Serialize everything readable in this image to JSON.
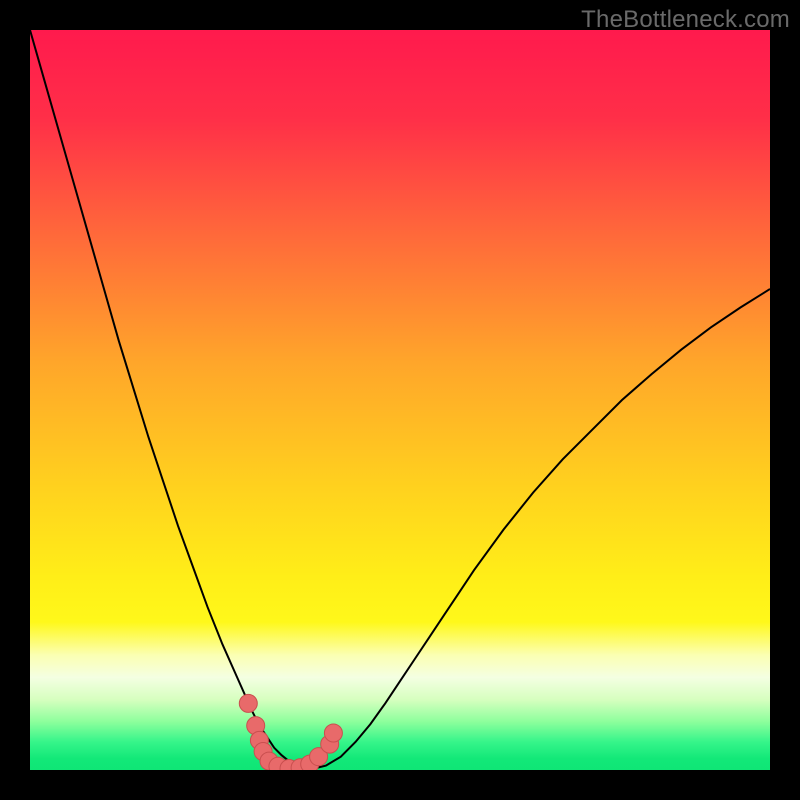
{
  "watermark": "TheBottleneck.com",
  "colors": {
    "frame": "#000000",
    "gradient_stops": [
      {
        "offset": 0.0,
        "color": "#ff1a4d"
      },
      {
        "offset": 0.12,
        "color": "#ff2f48"
      },
      {
        "offset": 0.28,
        "color": "#ff6a3a"
      },
      {
        "offset": 0.45,
        "color": "#ffa62a"
      },
      {
        "offset": 0.62,
        "color": "#ffd21e"
      },
      {
        "offset": 0.74,
        "color": "#ffee18"
      },
      {
        "offset": 0.8,
        "color": "#fff81a"
      },
      {
        "offset": 0.845,
        "color": "#fbffb3"
      },
      {
        "offset": 0.875,
        "color": "#f4ffe2"
      },
      {
        "offset": 0.905,
        "color": "#d6ffbf"
      },
      {
        "offset": 0.935,
        "color": "#8cff9c"
      },
      {
        "offset": 0.962,
        "color": "#36f58a"
      },
      {
        "offset": 0.985,
        "color": "#12e878"
      },
      {
        "offset": 1.0,
        "color": "#0fe676"
      }
    ],
    "curve": "#000000",
    "marker_fill": "#e86a6a",
    "marker_stroke": "#c94f4f"
  },
  "chart_data": {
    "type": "line",
    "title": "",
    "xlabel": "",
    "ylabel": "",
    "xlim": [
      0,
      100
    ],
    "ylim": [
      0,
      100
    ],
    "x": [
      0,
      2,
      4,
      6,
      8,
      10,
      12,
      14,
      16,
      18,
      20,
      22,
      24,
      26,
      28,
      30,
      31,
      32,
      33,
      34,
      35,
      36,
      37,
      38,
      40,
      42,
      44,
      46,
      48,
      50,
      52,
      54,
      56,
      58,
      60,
      64,
      68,
      72,
      76,
      80,
      84,
      88,
      92,
      96,
      100
    ],
    "series": [
      {
        "name": "left-curve",
        "values": [
          100,
          93,
          86,
          79,
          72,
          65,
          58,
          51.5,
          45,
          39,
          33,
          27.5,
          22,
          17,
          12.5,
          8,
          6,
          4.5,
          3,
          2,
          1.2,
          0.7,
          0.3,
          0.1,
          null,
          null,
          null,
          null,
          null,
          null,
          null,
          null,
          null,
          null,
          null,
          null,
          null,
          null,
          null,
          null,
          null,
          null,
          null,
          null,
          null
        ]
      },
      {
        "name": "right-curve",
        "values": [
          null,
          null,
          null,
          null,
          null,
          null,
          null,
          null,
          null,
          null,
          null,
          null,
          null,
          null,
          null,
          null,
          null,
          null,
          null,
          null,
          null,
          null,
          null,
          0.1,
          0.6,
          1.8,
          3.8,
          6.2,
          9,
          12,
          15,
          18,
          21,
          24,
          27,
          32.5,
          37.5,
          42,
          46,
          50,
          53.5,
          56.8,
          59.8,
          62.5,
          65
        ]
      }
    ],
    "markers": {
      "name": "highlight-points",
      "points": [
        {
          "x": 29.5,
          "y": 9
        },
        {
          "x": 30.5,
          "y": 6
        },
        {
          "x": 31,
          "y": 4
        },
        {
          "x": 31.5,
          "y": 2.5
        },
        {
          "x": 32.3,
          "y": 1.2
        },
        {
          "x": 33.5,
          "y": 0.5
        },
        {
          "x": 35,
          "y": 0.2
        },
        {
          "x": 36.5,
          "y": 0.3
        },
        {
          "x": 37.8,
          "y": 0.8
        },
        {
          "x": 39,
          "y": 1.8
        },
        {
          "x": 40.5,
          "y": 3.5
        },
        {
          "x": 41,
          "y": 5
        }
      ]
    }
  }
}
